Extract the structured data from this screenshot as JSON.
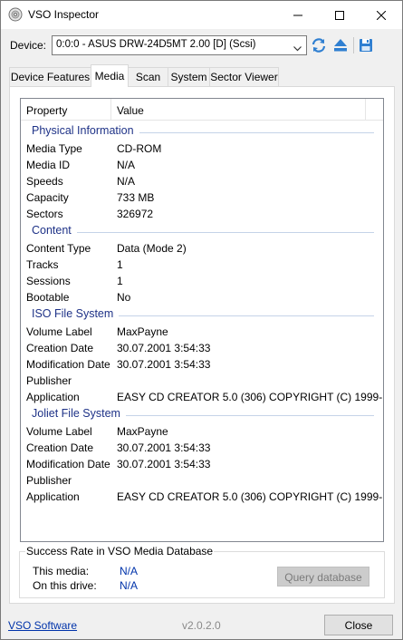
{
  "window": {
    "title": "VSO Inspector"
  },
  "device": {
    "label": "Device:",
    "selected": "0:0:0 - ASUS DRW-24D5MT 2.00 [D] (Scsi)"
  },
  "tabs": [
    {
      "label": "Device Features",
      "active": false
    },
    {
      "label": "Media",
      "active": true
    },
    {
      "label": "Scan",
      "active": false
    },
    {
      "label": "System",
      "active": false
    },
    {
      "label": "Sector Viewer",
      "active": false
    }
  ],
  "listview": {
    "columns": [
      "Property",
      "Value"
    ],
    "groups": [
      {
        "title": "Physical Information",
        "rows": [
          {
            "property": "Media Type",
            "value": "CD-ROM"
          },
          {
            "property": "Media ID",
            "value": "N/A"
          },
          {
            "property": "Speeds",
            "value": "N/A"
          },
          {
            "property": "Capacity",
            "value": "733 MB"
          },
          {
            "property": "Sectors",
            "value": "326972"
          }
        ]
      },
      {
        "title": "Content",
        "rows": [
          {
            "property": "Content Type",
            "value": "Data (Mode 2)"
          },
          {
            "property": "Tracks",
            "value": "1"
          },
          {
            "property": "Sessions",
            "value": "1"
          },
          {
            "property": "Bootable",
            "value": "No"
          }
        ]
      },
      {
        "title": "ISO File System",
        "rows": [
          {
            "property": "Volume Label",
            "value": "MaxPayne"
          },
          {
            "property": "Creation Date",
            "value": "30.07.2001 3:54:33"
          },
          {
            "property": "Modification Date",
            "value": "30.07.2001 3:54:33"
          },
          {
            "property": "Publisher",
            "value": ""
          },
          {
            "property": "Application",
            "value": "EASY CD CREATOR 5.0 (306) COPYRIGHT (C) 1999-..."
          }
        ]
      },
      {
        "title": "Joliet File System",
        "rows": [
          {
            "property": "Volume Label",
            "value": "MaxPayne"
          },
          {
            "property": "Creation Date",
            "value": "30.07.2001 3:54:33"
          },
          {
            "property": "Modification Date",
            "value": "30.07.2001 3:54:33"
          },
          {
            "property": "Publisher",
            "value": ""
          },
          {
            "property": "Application",
            "value": "EASY CD CREATOR 5.0 (306) COPYRIGHT (C) 1999-..."
          }
        ]
      }
    ]
  },
  "success_rate": {
    "title": "Success Rate in VSO Media Database",
    "this_media_label": "This media:",
    "this_media_value": "N/A",
    "this_drive_label": "On this drive:",
    "this_drive_value": "N/A",
    "query_button": "Query database"
  },
  "footer": {
    "link": "VSO Software",
    "version": "v2.0.2.0",
    "close_button": "Close"
  },
  "colors": {
    "group_title": "#1e3287",
    "link": "#0033aa",
    "accent_icon": "#2f7fd1"
  }
}
